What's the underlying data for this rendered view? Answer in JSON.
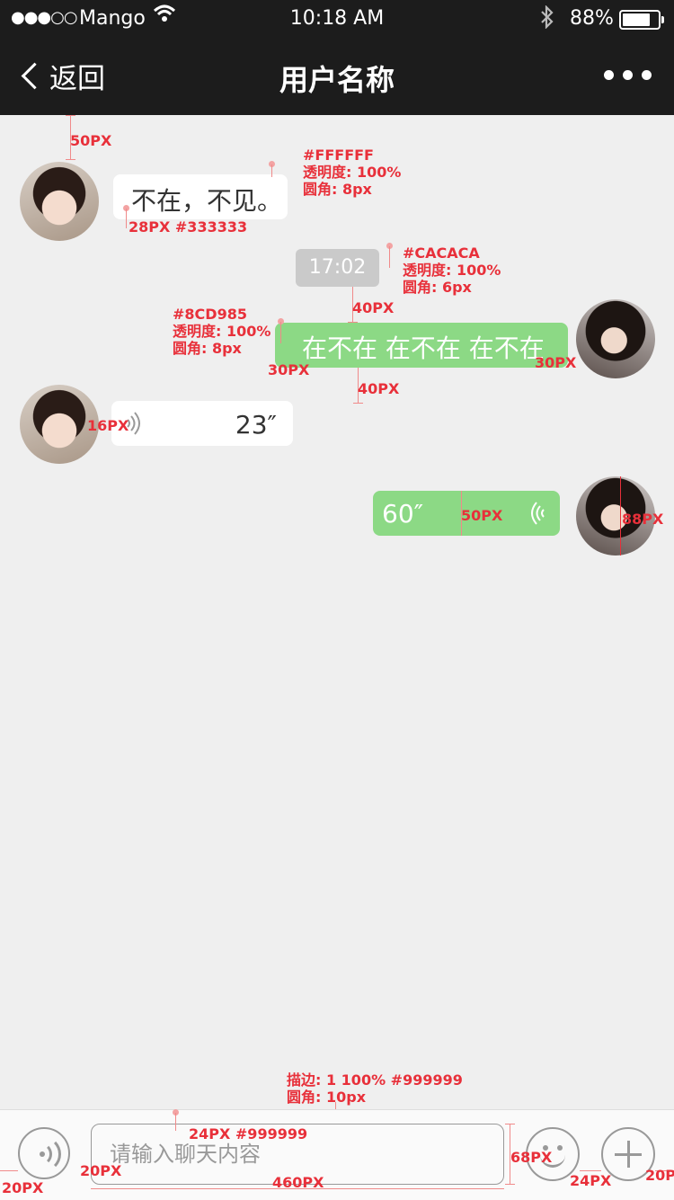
{
  "status_bar": {
    "signal": "●●●○○",
    "carrier": "Mango",
    "time": "10:18 AM",
    "battery": "88%",
    "battery_level": 0.88
  },
  "nav": {
    "back_label": "返回",
    "title": "用户名称"
  },
  "messages": {
    "m1_text": "不在，不见。",
    "timestamp": "17:02",
    "m2_text": "在不在 在不在 在不在",
    "m3_duration": "23″",
    "m4_duration": "60″"
  },
  "input": {
    "placeholder": "请输入聊天内容"
  },
  "annotations": {
    "top_gap": "50PX",
    "white_bubble_spec": [
      "#FFFFFF",
      "透明度: 100%",
      "圆角: 8px"
    ],
    "text_spec": "28PX #333333",
    "time_spec": [
      "#CACACA",
      "透明度: 100%",
      "圆角: 6px"
    ],
    "gap_40_a": "40PX",
    "green_spec": [
      "#8CD985",
      "透明度: 100%",
      "圆角: 8px"
    ],
    "pad_30_left": "30PX",
    "pad_30_right": "30PX",
    "gap_40_b": "40PX",
    "pad_16": "16PX",
    "height_50": "50PX",
    "avatar_88": "88PX",
    "input_border_spec": [
      "描边: 1 100% #999999",
      "圆角: 10px"
    ],
    "placeholder_spec": "24PX #999999",
    "height_68": "68PX",
    "margin_20_left": "20PX",
    "gap_20": "20PX",
    "width_460": "460PX",
    "gap_24": "24PX",
    "margin_20_right": "20P"
  },
  "colors": {
    "bar": "#1c1c1c",
    "background": "#efefef",
    "white_bubble": "#FFFFFF",
    "green_bubble": "#8CD985",
    "timestamp": "#CACACA",
    "annotation": "#e8303a"
  }
}
